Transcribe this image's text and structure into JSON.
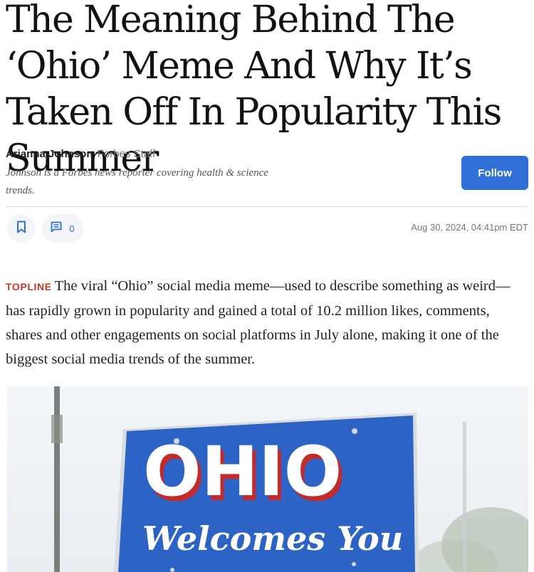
{
  "article": {
    "headline": "The Meaning Behind The ‘Ohio’ Meme And Why It’s Taken Off In Popularity This Summer",
    "author_name": "Arianna Johnson",
    "author_role": "Forbes Staff",
    "author_bio": "Johnson is a Forbes news reporter covering health & science trends.",
    "follow_label": "Follow",
    "comment_count": "0",
    "timestamp": "Aug 30, 2024, 04:41pm EDT",
    "topline_label": "TOPLINE",
    "topline_text": "The viral “Ohio” social media meme—used to describe something as weird—has rapidly grown in popularity and gained a total of 10.2 million likes, comments, shares and other engagements on social platforms in July alone, making it one of the biggest social media trends of the summer."
  },
  "hero": {
    "sign_title": "OHIO",
    "sign_subtitle": "Welcomes You"
  },
  "colors": {
    "accent": "#2f6fd6",
    "topline": "#c0392b",
    "sign_blue": "#2c63c4",
    "sign_red": "#c32a2a"
  },
  "icons": [
    "bookmark-icon",
    "comment-icon"
  ]
}
